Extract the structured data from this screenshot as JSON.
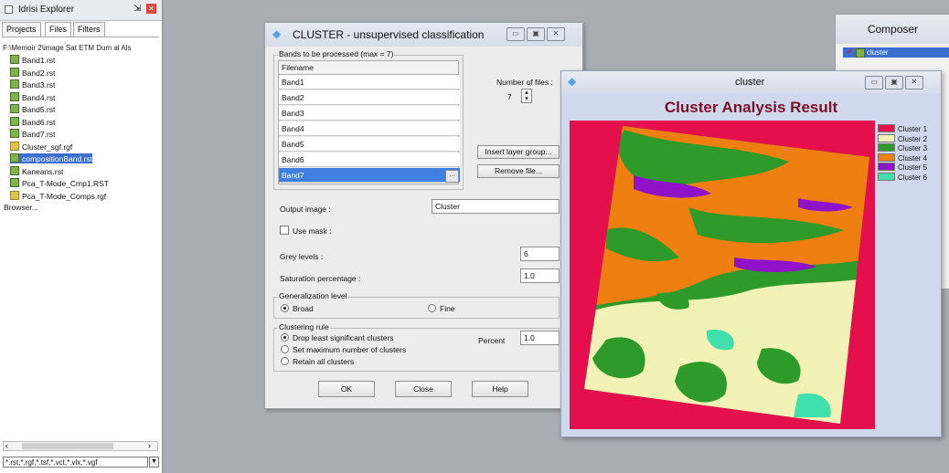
{
  "explorer": {
    "title": "Idrisi Explorer",
    "tabs": [
      "Projects",
      "Files",
      "Filters"
    ],
    "path": "F:\\Memoir 2\\image Sat ETM Dum al Als",
    "files": [
      {
        "name": "Band1.rst",
        "icon": "raster-layer-icon"
      },
      {
        "name": "Band2.rst",
        "icon": "raster-layer-icon"
      },
      {
        "name": "Band3.rst",
        "icon": "raster-layer-icon"
      },
      {
        "name": "Band4.rst",
        "icon": "raster-layer-icon"
      },
      {
        "name": "Band5.rst",
        "icon": "raster-layer-icon"
      },
      {
        "name": "Band6.rst",
        "icon": "raster-layer-icon"
      },
      {
        "name": "Band7.rst",
        "icon": "raster-layer-icon"
      },
      {
        "name": "Cluster_sgf.rgf",
        "icon": "group-file-icon"
      },
      {
        "name": "compositionBand.rst",
        "icon": "raster-layer-icon",
        "selected": true
      },
      {
        "name": "Kaneans.rst",
        "icon": "raster-layer-icon"
      },
      {
        "name": "Pca_T-Mode_Cmp1.RST",
        "icon": "raster-layer-icon"
      },
      {
        "name": "Pca_T-Mode_Comps.rgf",
        "icon": "group-file-icon"
      }
    ],
    "browser_label": "Browser...",
    "filter": "*.rst,*.rgf,*.tsf,*.vct,*.vlx,*.vgf"
  },
  "dialog": {
    "title": "CLUSTER - unsupervised classification",
    "bands_group": "Bands to be processed (max = 7)",
    "filename_header": "Filename",
    "bands": [
      "Band1",
      "Band2",
      "Band3",
      "Band4",
      "Band5",
      "Band6",
      "Band7"
    ],
    "files_label": "Number of files :",
    "files_count": "7",
    "insert_label": "Insert layer group...",
    "remove_label": "Remove file...",
    "output_label": "Output image :",
    "output_value": "Cluster",
    "mask_label": "Use mask :",
    "grey_label": "Grey levels :",
    "grey_value": "6",
    "saturation_label": "Saturation percentage :",
    "saturation_value": "1.0",
    "general_group": "Generalization level",
    "general_options": [
      "Broad",
      "Fine"
    ],
    "rule_group": "Clustering rule",
    "rule_options": [
      "Drop least significant clusters",
      "Set maximum number of clusters",
      "Retain all clusters"
    ],
    "percent_label": "Percent",
    "percent_value": "1.0",
    "ok_label": "OK",
    "close_label": "Close",
    "help_label": "Help"
  },
  "cluster_window": {
    "title": "cluster",
    "heading": "Cluster Analysis Result",
    "legend": [
      {
        "name": "Cluster 1",
        "color": "#e40f4c"
      },
      {
        "name": "Cluster 2",
        "color": "#f2f2b6"
      },
      {
        "name": "Cluster 3",
        "color": "#2e9a2a"
      },
      {
        "name": "Cluster 4",
        "color": "#f07f12"
      },
      {
        "name": "Cluster 5",
        "color": "#8f12c8"
      },
      {
        "name": "Cluster 6",
        "color": "#3fe0ab"
      }
    ]
  },
  "composer": {
    "title": "Composer",
    "layer": "cluster"
  }
}
